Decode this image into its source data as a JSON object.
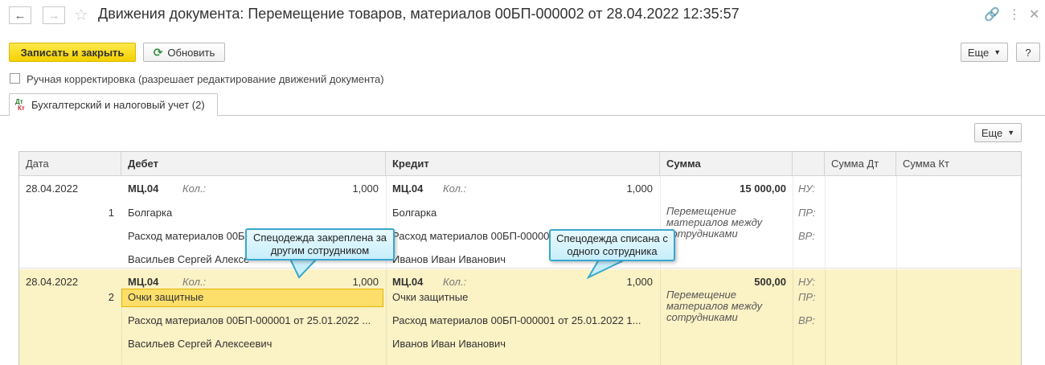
{
  "window": {
    "title": "Движения документа: Перемещение товаров, материалов 00БП-000002 от 28.04.2022 12:35:57"
  },
  "toolbar": {
    "save_close": "Записать и закрыть",
    "refresh": "Обновить",
    "more": "Еще",
    "help": "?"
  },
  "manual_checkbox_label": "Ручная корректировка (разрешает редактирование движений документа)",
  "tab": {
    "label": "Бухгалтерский и налоговый учет (2)",
    "icon_top": "Дт",
    "icon_bottom": "Кт"
  },
  "table_toolbar": {
    "more": "Еще"
  },
  "table": {
    "headers": [
      "Дата",
      "Дебет",
      "Кредит",
      "Сумма",
      "",
      "Сумма Дт",
      "Сумма Кт"
    ],
    "rows": [
      {
        "date": "28.04.2022",
        "num": "1",
        "debit_account": "МЦ.04",
        "qty_label": "Кол.:",
        "debit_qty": "1,000",
        "debit_lines": [
          "Болгарка",
          "Расход материалов 00БП",
          "Васильев Сергей Алексе"
        ],
        "credit_account": "МЦ.04",
        "credit_qty": "1,000",
        "credit_lines": [
          "Болгарка",
          "Расход материалов 00БП-00000",
          "Иванов Иван Иванович"
        ],
        "sum": "15 000,00",
        "content": "Перемещение материалов между сотрудниками",
        "flags": [
          "НУ:",
          "ПР:",
          "ВР:"
        ]
      },
      {
        "date": "28.04.2022",
        "num": "2",
        "debit_account": "МЦ.04",
        "qty_label": "Кол.:",
        "debit_qty": "1,000",
        "debit_lines": [
          "Очки защитные",
          "Расход материалов 00БП-000001 от 25.01.2022 ...",
          "Васильев Сергей Алексеевич"
        ],
        "credit_account": "МЦ.04",
        "credit_qty": "1,000",
        "credit_lines": [
          "Очки защитные",
          "Расход материалов 00БП-000001 от 25.01.2022 1...",
          "Иванов Иван Иванович"
        ],
        "sum": "500,00",
        "content": "Перемещение материалов между сотрудниками",
        "flags": [
          "НУ:",
          "ПР:",
          "ВР:"
        ]
      }
    ]
  },
  "callouts": {
    "left": "Спецодежда закреплена за другим сотрудником",
    "right": "Спецодежда списана с одного сотрудника"
  }
}
